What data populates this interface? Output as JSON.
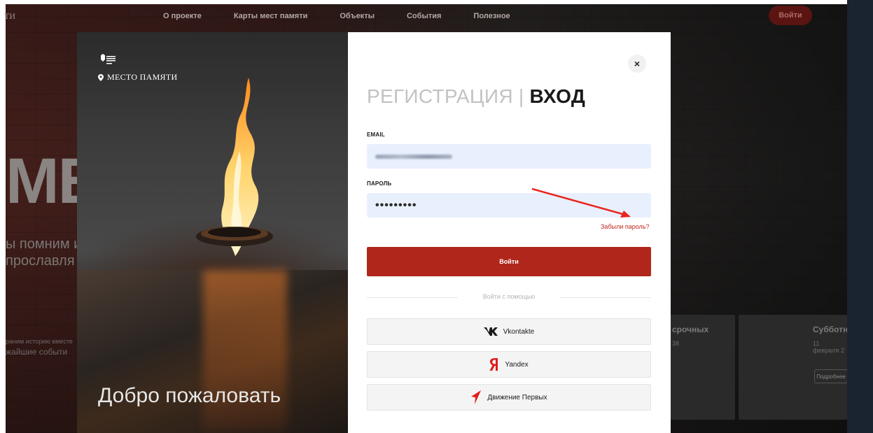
{
  "site": {
    "logo_fragment": "ТИ",
    "nav": [
      "О проекте",
      "Карты мест памяти",
      "Объекты",
      "События",
      "Полезное"
    ],
    "login_button": "Войти"
  },
  "hero": {
    "big_text": "МЕ",
    "line1": "ы помним и",
    "line2": "прославля",
    "small1": "раним историю вместе",
    "small2": "жайшие событи"
  },
  "cards": [
    {
      "title": "срочных",
      "date": "38",
      "button": ""
    },
    {
      "title": "Субботн",
      "date": "11 февраля 2",
      "button": "Подробнее"
    }
  ],
  "left_panel": {
    "brand": "МЕСТО ПАМЯТИ",
    "welcome": "Добро пожаловать"
  },
  "modal": {
    "tab_register": "РЕГИСТРАЦИЯ",
    "separator": "|",
    "tab_login": "ВХОД",
    "close_symbol": "×",
    "email_label": "EMAIL",
    "password_label": "ПАРОЛЬ",
    "password_value": "•••••••••",
    "forgot_password": "Забыли пароль?",
    "submit": "Войти",
    "social_divider": "Войти с помощью",
    "social": [
      {
        "label": "Vkontakte",
        "icon": "vk-icon"
      },
      {
        "label": "Yandex",
        "icon": "yandex-icon"
      },
      {
        "label": "Движение Первых",
        "icon": "dvizhenie-pervykh-icon"
      }
    ]
  },
  "colors": {
    "accent": "#b0261a",
    "link": "#c0281c",
    "input_bg": "#e8f0fe",
    "annotation_arrow": "#e8261c"
  }
}
